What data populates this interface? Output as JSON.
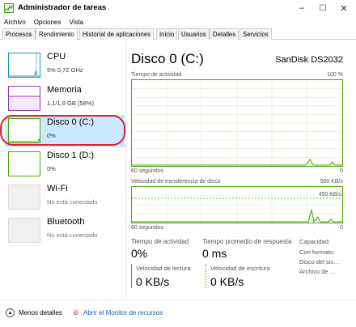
{
  "window": {
    "title": "Administrador de tareas",
    "controls": {
      "minimize": "–",
      "maximize": "☐",
      "close": "✕"
    }
  },
  "menu": [
    "Archivo",
    "Opciones",
    "Vista"
  ],
  "tabs": [
    {
      "label": "Procesos",
      "active": false
    },
    {
      "label": "Rendimiento",
      "active": true
    },
    {
      "label": "Historial de aplicaciones",
      "active": false
    },
    {
      "label": "Inicio",
      "active": false
    },
    {
      "label": "Usuarios",
      "active": false
    },
    {
      "label": "Detalles",
      "active": false
    },
    {
      "label": "Servicios",
      "active": false
    }
  ],
  "sidebar": {
    "items": [
      {
        "title": "CPU",
        "sub": "5% 0,72 GHz",
        "color": "#1797c0"
      },
      {
        "title": "Memoria",
        "sub": "1,1/1,9 GB (58%)",
        "color": "#8e3ab0"
      },
      {
        "title": "Disco 0 (C:)",
        "sub": "0%",
        "color": "#4da60c",
        "selected": true
      },
      {
        "title": "Disco 1 (D:)",
        "sub": "0%",
        "color": "#4da60c"
      },
      {
        "title": "Wi-Fi",
        "sub": "No está conectado",
        "color": "#cccccc"
      },
      {
        "title": "Bluetooth",
        "sub": "No está conectado",
        "color": "#cccccc"
      }
    ]
  },
  "main": {
    "title": "Disco 0 (C:)",
    "device": "SanDisk DS2032",
    "activity_graph": {
      "label": "Tiempo de actividad",
      "max": "100 %",
      "time": "60 segundos",
      "min": "0"
    },
    "transfer_graph": {
      "label": "Velocidad de transferencia de disco",
      "max": "500 KB/s",
      "mark": "450 KB/s",
      "time": "60 segundos",
      "min": "0"
    },
    "stats": {
      "activity_label": "Tiempo de actividad",
      "activity_value": "0%",
      "response_label": "Tiempo promedio de respuesta",
      "response_value": "0 ms",
      "read_label": "Velocidad de lectura",
      "read_value": "0 KB/s",
      "write_label": "Velocidad de escritura",
      "write_value": "0 KB/s"
    },
    "props": [
      "Capacidad:",
      "Con formato:",
      "Disco del sis…",
      "Archivo de …"
    ]
  },
  "footer": {
    "less_details": "Menos detalles",
    "resource_monitor": "Abrir el Monitor de recursos"
  }
}
